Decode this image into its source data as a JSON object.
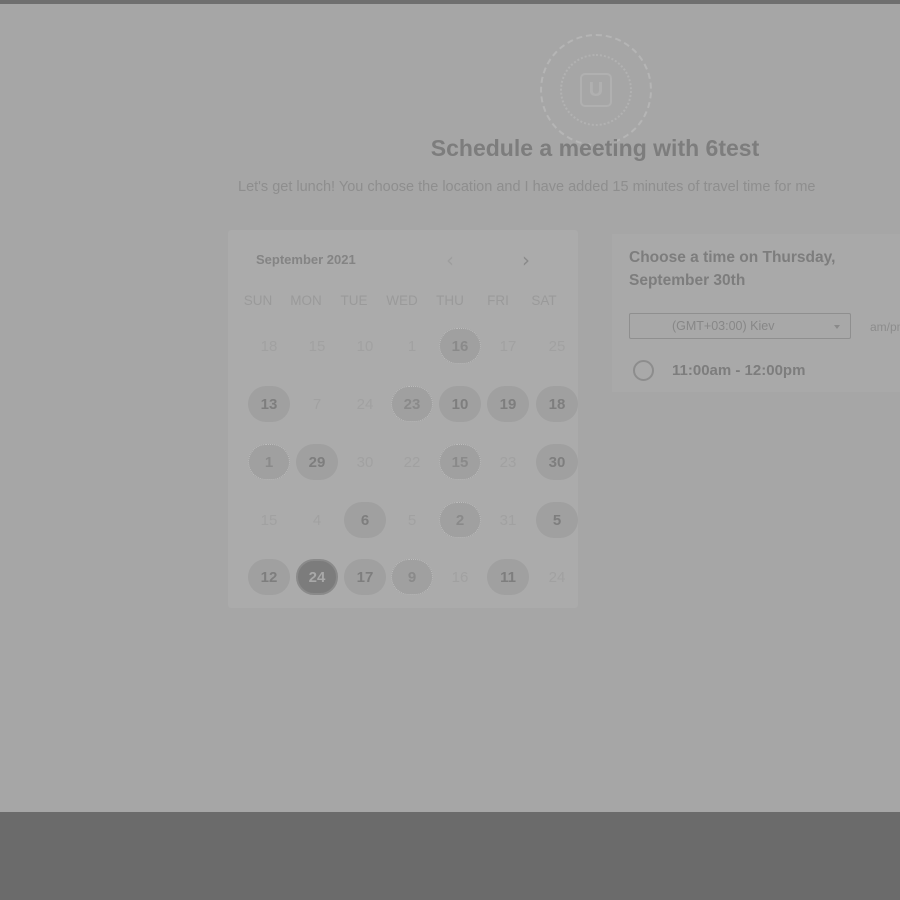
{
  "header": {
    "logo_letter": "U",
    "title": "Schedule a meeting with 6test",
    "description": "Let's get lunch! You choose the location and I have added 15 minutes of travel time for me"
  },
  "calendar": {
    "month_label": "September 2021",
    "prev_icon": "‹",
    "next_icon": "›",
    "weekdays": [
      "SUN",
      "MON",
      "TUE",
      "WED",
      "THU",
      "FRI",
      "SAT"
    ],
    "weeks": [
      [
        {
          "label": "18",
          "state": "dim"
        },
        {
          "label": "15",
          "state": "dim"
        },
        {
          "label": "10",
          "state": "dim"
        },
        {
          "label": "1",
          "state": "dim"
        },
        {
          "label": "16",
          "state": "fancy"
        },
        {
          "label": "17",
          "state": "dim"
        },
        {
          "label": "25",
          "state": "dim"
        }
      ],
      [
        {
          "label": "13",
          "state": "available"
        },
        {
          "label": "7",
          "state": "dim"
        },
        {
          "label": "24",
          "state": "dim"
        },
        {
          "label": "23",
          "state": "fancy"
        },
        {
          "label": "10",
          "state": "available"
        },
        {
          "label": "19",
          "state": "available"
        },
        {
          "label": "18",
          "state": "available"
        }
      ],
      [
        {
          "label": "1",
          "state": "fancy"
        },
        {
          "label": "29",
          "state": "available"
        },
        {
          "label": "30",
          "state": "dim"
        },
        {
          "label": "22",
          "state": "dim"
        },
        {
          "label": "15",
          "state": "fancy"
        },
        {
          "label": "23",
          "state": "dim"
        },
        {
          "label": "30",
          "state": "available"
        }
      ],
      [
        {
          "label": "15",
          "state": "dim"
        },
        {
          "label": "4",
          "state": "dim"
        },
        {
          "label": "6",
          "state": "available"
        },
        {
          "label": "5",
          "state": "dim"
        },
        {
          "label": "2",
          "state": "fancy"
        },
        {
          "label": "31",
          "state": "dim"
        },
        {
          "label": "5",
          "state": "available"
        }
      ],
      [
        {
          "label": "12",
          "state": "available"
        },
        {
          "label": "24",
          "state": "selected"
        },
        {
          "label": "17",
          "state": "available"
        },
        {
          "label": "9",
          "state": "fancy"
        },
        {
          "label": "16",
          "state": "dim"
        },
        {
          "label": "11",
          "state": "available"
        },
        {
          "label": "24",
          "state": "dim"
        }
      ]
    ]
  },
  "time_panel": {
    "heading": "Choose a time on Thursday, September 30th",
    "timezone": "(GMT+03:00) Kiev",
    "format_label": "am/pm",
    "slots": [
      {
        "label": "11:00am - 12:00pm"
      }
    ]
  },
  "colors": {
    "overlay_page": "#a6a6a6",
    "bottom_bar": "#6b6b6b",
    "selected_day": "#7c7c7c"
  }
}
